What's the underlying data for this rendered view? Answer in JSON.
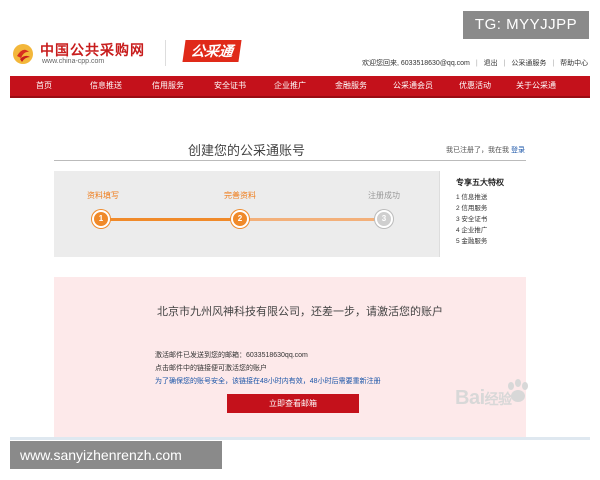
{
  "header": {
    "site_name": "中国公共采购网",
    "site_url": "www.china-cpp.com",
    "brand": "公采通",
    "links": [
      "欢迎您回来, 6033518630@qq.com",
      "退出",
      "公采通服务",
      "帮助中心"
    ]
  },
  "tag": "TG: MYYJJPP",
  "nav": {
    "items": [
      "首页",
      "信息推送",
      "信用服务",
      "安全证书",
      "企业推广",
      "金融服务",
      "公采通会员",
      "优惠活动",
      "关于公采通"
    ]
  },
  "page": {
    "title": "创建您的公采通账号",
    "login_prompt": "我已注册了，我在我",
    "login_link": "登录"
  },
  "steps": [
    {
      "label": "资料填写",
      "number": "1",
      "state": "done"
    },
    {
      "label": "完善资料",
      "number": "2",
      "state": "done"
    },
    {
      "label": "注册成功",
      "number": "3",
      "state": "todo"
    }
  ],
  "perks": {
    "title": "专享五大特权",
    "items": [
      "1 信息推送",
      "2 信用服务",
      "3 安全证书",
      "4 企业推广",
      "5 金融服务"
    ]
  },
  "activation": {
    "heading": "北京市九州风神科技有限公司，还差一步，请激活您的账户",
    "line1": "激活邮件已发送到您的邮箱：6033518630qq.com",
    "line2": "点击邮件中的链接便可激活您的账户",
    "line3": "为了确保您的账号安全，该链接在48小时内有效，48小时后需要重新注册",
    "button": "立即查看邮箱"
  },
  "watermark": {
    "text": "Bai",
    "suffix": "经验"
  },
  "footer_url": "www.sanyizhenrenzh.com",
  "colors": {
    "nav_red": "#c4111b",
    "step_orange": "#f08a2a",
    "activate_bg": "#fde9ea",
    "link_blue": "#1a55a8"
  }
}
